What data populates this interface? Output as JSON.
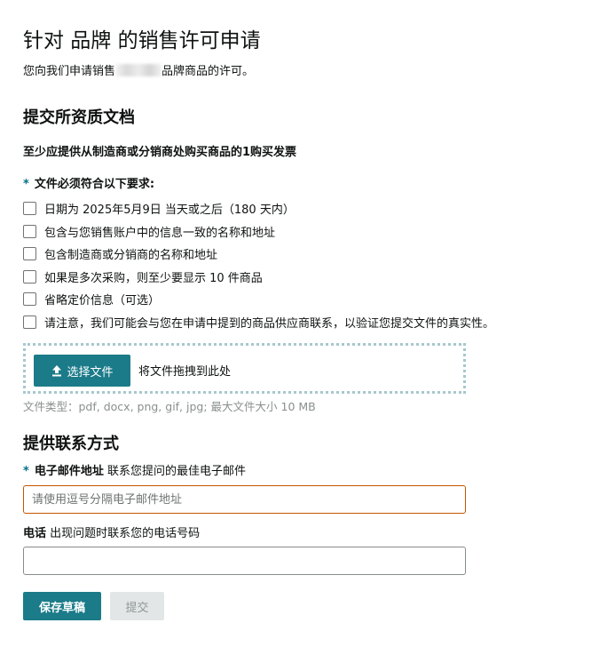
{
  "page": {
    "title": "针对 品牌 的销售许可申请",
    "subtitle_prefix": "您向我们申请销售",
    "subtitle_suffix": "品牌商品的许可。"
  },
  "documents": {
    "heading": "提交所资质文档",
    "requirement": "至少应提供从制造商或分销商处购买商品的1购买发票",
    "required_marker": "*",
    "criteria_label": "文件必须符合以下要求:",
    "checklist": [
      "日期为 2025年5月9日 当天或之后（180 天内）",
      "包含与您销售账户中的信息一致的名称和地址",
      "包含制造商或分销商的名称和地址",
      "如果是多次采购，则至少要显示 10 件商品",
      "省略定价信息（可选）",
      "请注意，我们可能会与您在申请中提到的商品供应商联系，以验证您提交文件的真实性。"
    ],
    "upload_button": "选择文件",
    "drop_text": "将文件拖拽到此处",
    "file_types": "文件类型：pdf, docx, png, gif, jpg; 最大文件大小 10 MB"
  },
  "contact": {
    "heading": "提供联系方式",
    "required_marker": "*",
    "email_label": "电子邮件地址",
    "email_hint": "联系您提问的最佳电子邮件",
    "email_placeholder": "请使用逗号分隔电子邮件地址",
    "phone_label": "电话",
    "phone_hint": "出现问题时联系您的电话号码",
    "phone_value": ""
  },
  "actions": {
    "save_draft": "保存草稿",
    "submit": "提交"
  },
  "colors": {
    "primary": "#1b7b89",
    "error_border": "#c45500",
    "disabled_bg": "#e3e6e6"
  }
}
